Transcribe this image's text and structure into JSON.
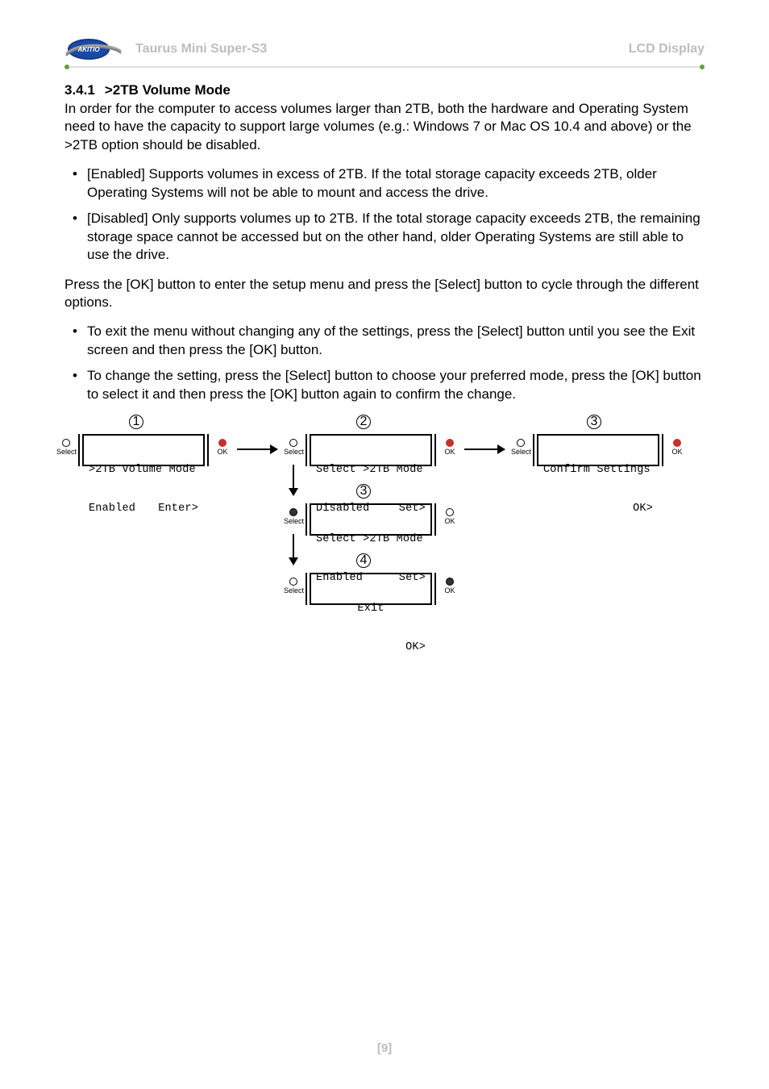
{
  "header": {
    "left": "Taurus Mini Super-S3",
    "right": "LCD Display",
    "logo_text": "AKITIO"
  },
  "section": {
    "number": "3.4.1",
    "title": ">2TB Volume Mode"
  },
  "paragraphs": {
    "intro": "In order for the computer to access volumes larger than 2TB, both the hardware and Operating System need to have the capacity to support large volumes (e.g.: Windows 7 or Mac OS 10.4 and above) or the >2TB option should be disabled.",
    "press": "Press the [OK] button to enter the setup menu and press the [Select] button to cycle through the different options."
  },
  "bullets1": [
    "[Enabled] Supports volumes in excess of 2TB. If the total storage capacity exceeds 2TB, older Operating Systems will not be able to mount and access the drive.",
    "[Disabled] Only supports volumes up to 2TB. If the total storage capacity exceeds 2TB, the remaining storage space cannot be accessed but on the other hand, older Operating Systems are still able to use the drive."
  ],
  "bullets2": [
    "To exit the menu without changing any of the settings, press the [Select] button until you see the Exit screen and then press the [OK] button.",
    "To change the setting, press the [Select] button to choose your preferred mode, press the [OK] button to select it and then press the [OK] button again to confirm the change."
  ],
  "buttons": {
    "select": "Select",
    "ok": "OK"
  },
  "steps": {
    "s1": "1",
    "s2": "2",
    "s3": "3",
    "s4": "4"
  },
  "lcd": {
    "p1_l1": ">2TB Volume Mode",
    "p1_l2a": "Enabled",
    "p1_l2b": "Enter>",
    "p2_l1": "Select >2TB Mode",
    "p2_l2a": "Disabled",
    "p2_l2b": "Set>",
    "p3_l1": "Select >2TB Mode",
    "p3_l2a": "Enabled",
    "p3_l2b": "Set>",
    "p4_l1": "Exit",
    "p4_l2b": "OK>",
    "p5_l1": "Confirm Settings",
    "p5_l2b": "OK>"
  },
  "footer": "[9]"
}
